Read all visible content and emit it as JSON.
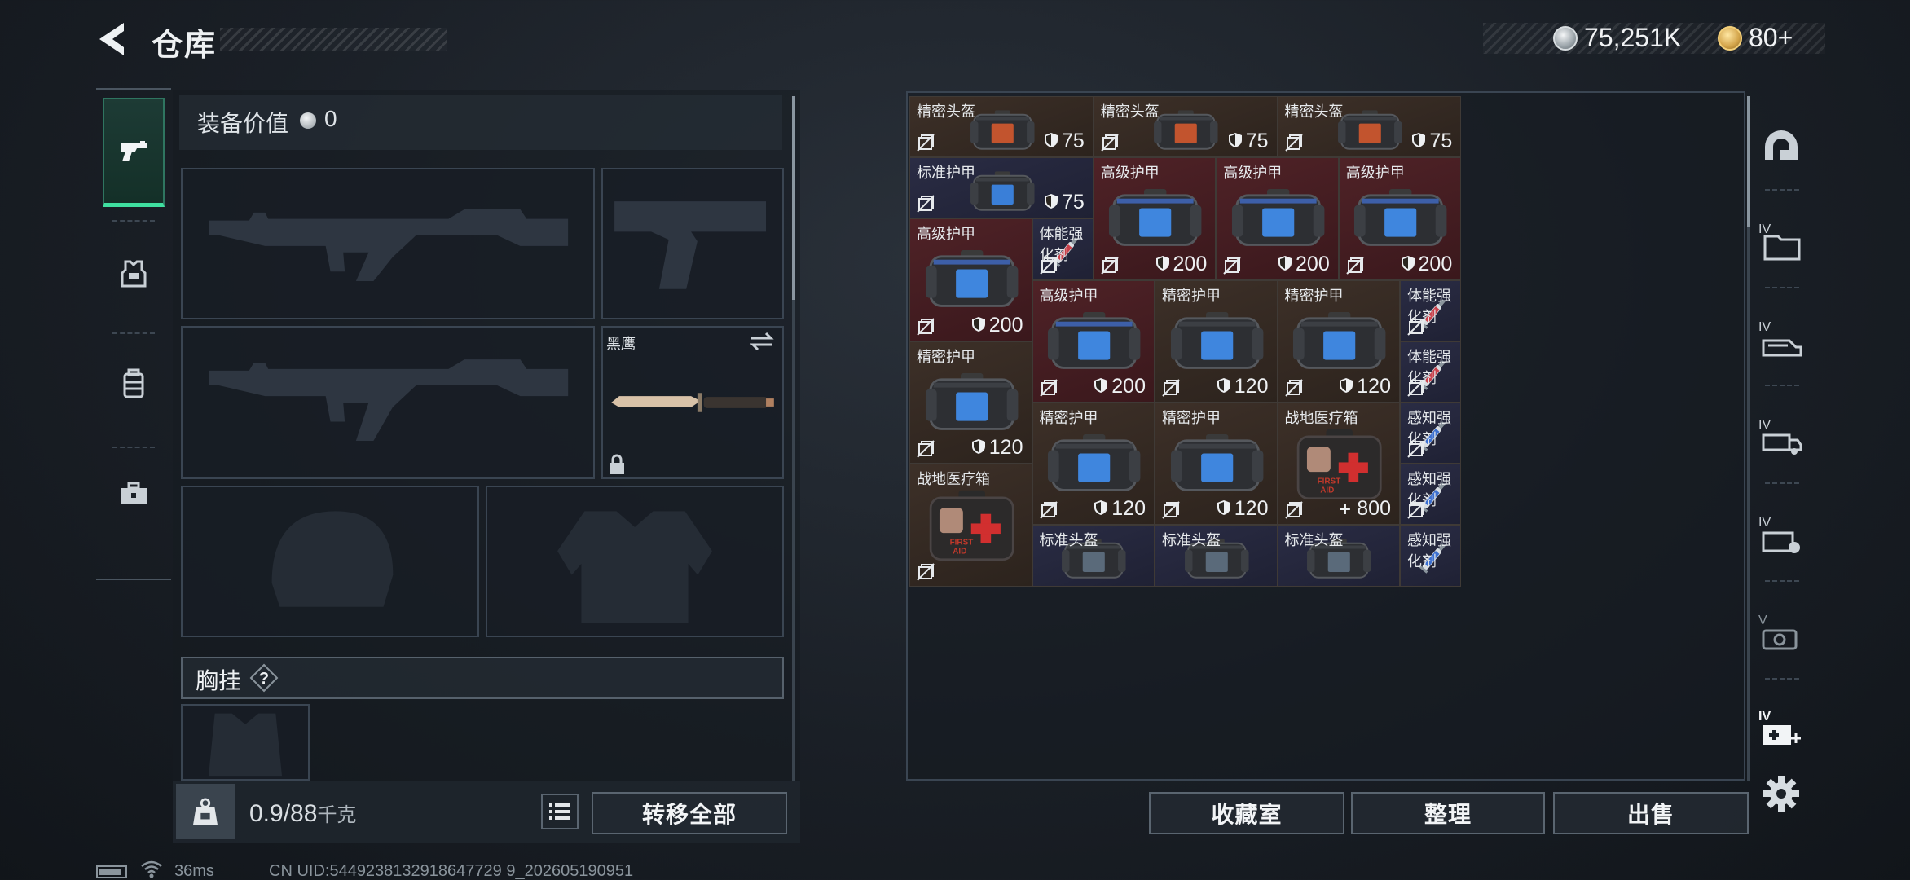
{
  "header": {
    "title": "仓库"
  },
  "currency": {
    "silver": "75,251K",
    "gold": "80+",
    "silver_color": "#c9cfd3",
    "gold_color": "#e2b65a"
  },
  "left_tabs": [
    {
      "icon": "pistol-icon",
      "active": true
    },
    {
      "icon": "armor-vest-icon",
      "active": false
    },
    {
      "icon": "backpack-icon",
      "active": false
    },
    {
      "icon": "toolbox-icon",
      "active": false
    }
  ],
  "equipment": {
    "value_label": "装备价值",
    "value": "0",
    "knife_name": "黑鹰",
    "chest_label": "胸挂",
    "chest_help": "?"
  },
  "footer_left": {
    "weight_current": "0.9",
    "weight_max": "/88",
    "weight_unit": "千克",
    "transfer_all": "转移全部"
  },
  "footer_right": {
    "collection": "收藏室",
    "sort": "整理",
    "sell": "出售"
  },
  "status": {
    "ping": "36ms",
    "uid": "CN UID:5449238132918647729 9_202605190951"
  },
  "inventory": {
    "items": [
      {
        "name": "精密头盔",
        "value": "75",
        "kind": "bag_helmet",
        "tint": "brown"
      },
      {
        "name": "精密头盔",
        "value": "75",
        "kind": "bag_helmet",
        "tint": "brown"
      },
      {
        "name": "精密头盔",
        "value": "75",
        "kind": "bag_helmet",
        "tint": "brown"
      },
      {
        "name": "标准护甲",
        "value": "75",
        "kind": "bag_armor_s",
        "tint": "navy"
      },
      {
        "name": "高级护甲",
        "value": "200",
        "kind": "bag_armor_l",
        "tint": "red"
      },
      {
        "name": "高级护甲",
        "value": "200",
        "kind": "bag_armor_l",
        "tint": "red"
      },
      {
        "name": "高级护甲",
        "value": "200",
        "kind": "bag_armor_l",
        "tint": "red"
      },
      {
        "name": "高级护甲",
        "value": "200",
        "kind": "bag_armor_l",
        "tint": "red"
      },
      {
        "name": "体能强化剂",
        "value": "",
        "kind": "syringe_red",
        "tint": "navy"
      },
      {
        "name": "高级护甲",
        "value": "200",
        "kind": "bag_armor_l",
        "tint": "red"
      },
      {
        "name": "精密护甲",
        "value": "120",
        "kind": "bag_armor_m",
        "tint": "brown"
      },
      {
        "name": "精密护甲",
        "value": "120",
        "kind": "bag_armor_m",
        "tint": "brown"
      },
      {
        "name": "体能强化剂",
        "value": "",
        "kind": "syringe_red",
        "tint": "navy"
      },
      {
        "name": "体能强化剂",
        "value": "",
        "kind": "syringe_red",
        "tint": "navy"
      },
      {
        "name": "精密护甲",
        "value": "120",
        "kind": "bag_armor_m",
        "tint": "brown"
      },
      {
        "name": "精密护甲",
        "value": "120",
        "kind": "bag_armor_m",
        "tint": "brown"
      },
      {
        "name": "精密护甲",
        "value": "120",
        "kind": "bag_armor_m",
        "tint": "brown"
      },
      {
        "name": "战地医疗箱",
        "value": "800",
        "kind": "medkit",
        "tint": "brown"
      },
      {
        "name": "感知强化剂",
        "value": "",
        "kind": "syringe_blue",
        "tint": "navy"
      },
      {
        "name": "感知强化剂",
        "value": "",
        "kind": "syringe_blue",
        "tint": "navy"
      },
      {
        "name": "战地医疗箱",
        "value": "",
        "kind": "medkit",
        "tint": "brown"
      },
      {
        "name": "标准头盔",
        "value": "",
        "kind": "bag_helmet_s",
        "tint": "navy"
      },
      {
        "name": "标准头盔",
        "value": "",
        "kind": "bag_helmet_s",
        "tint": "navy"
      },
      {
        "name": "标准头盔",
        "value": "",
        "kind": "bag_helmet_s",
        "tint": "navy"
      },
      {
        "name": "感知强化剂",
        "value": "",
        "kind": "syringe_blue",
        "tint": "navy"
      }
    ]
  },
  "right_rail": [
    "helmet-category-icon",
    "tier4-folder-icon",
    "tier4-vehicle-icon",
    "tier4-truck-icon",
    "tier4-device-icon",
    "tier4-gear-icon",
    "tier4-medical-icon"
  ]
}
